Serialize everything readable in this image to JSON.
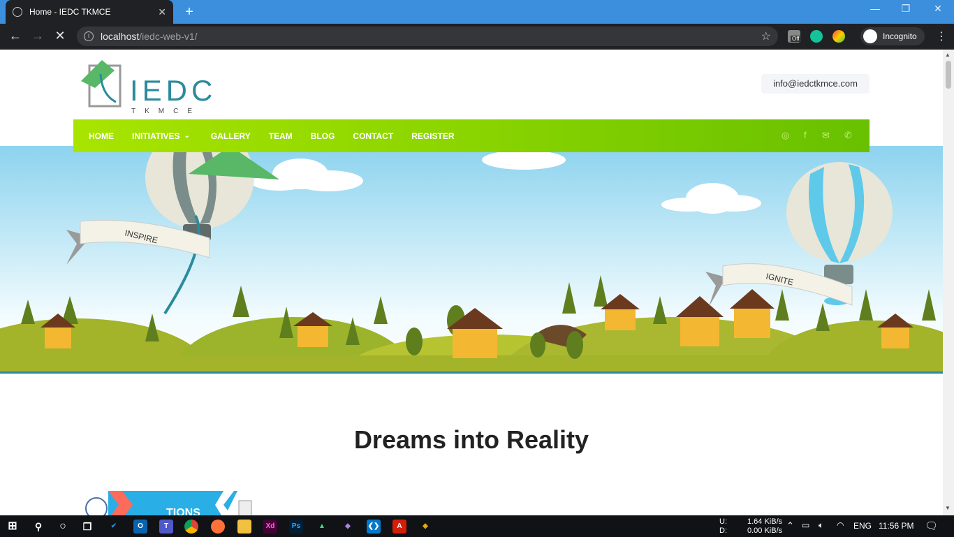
{
  "browser": {
    "tab_title": "Home - IEDC TKMCE",
    "tab_close": "✕",
    "new_tab": "+",
    "url_host": "localhost",
    "url_path": "/iedc-web-v1/",
    "profile_label": "Incognito",
    "ext_badge": "Off"
  },
  "site": {
    "logo_text": "IEDC",
    "logo_sub": "TKMCE",
    "email": "info@iedctkmce.com",
    "nav": [
      {
        "label": "HOME"
      },
      {
        "label": "INITIATIVES"
      },
      {
        "label": "GALLERY"
      },
      {
        "label": "TEAM"
      },
      {
        "label": "BLOG"
      },
      {
        "label": "CONTACT"
      },
      {
        "label": "REGISTER"
      }
    ],
    "banner_left": "INSPIRE",
    "banner_right": "IGNITE",
    "headline": "Dreams into Reality",
    "promo_text": "TIONS"
  },
  "taskbar": {
    "upload_label": "U:",
    "download_label": "D:",
    "upload_speed": "1.64 KiB/s",
    "download_speed": "0.00 KiB/s",
    "language": "ENG",
    "time": "11:56 PM"
  },
  "colors": {
    "nav_start": "#a8e400",
    "nav_end": "#68c000",
    "accent": "#2a8b9c",
    "hill": "#9cb32c"
  }
}
